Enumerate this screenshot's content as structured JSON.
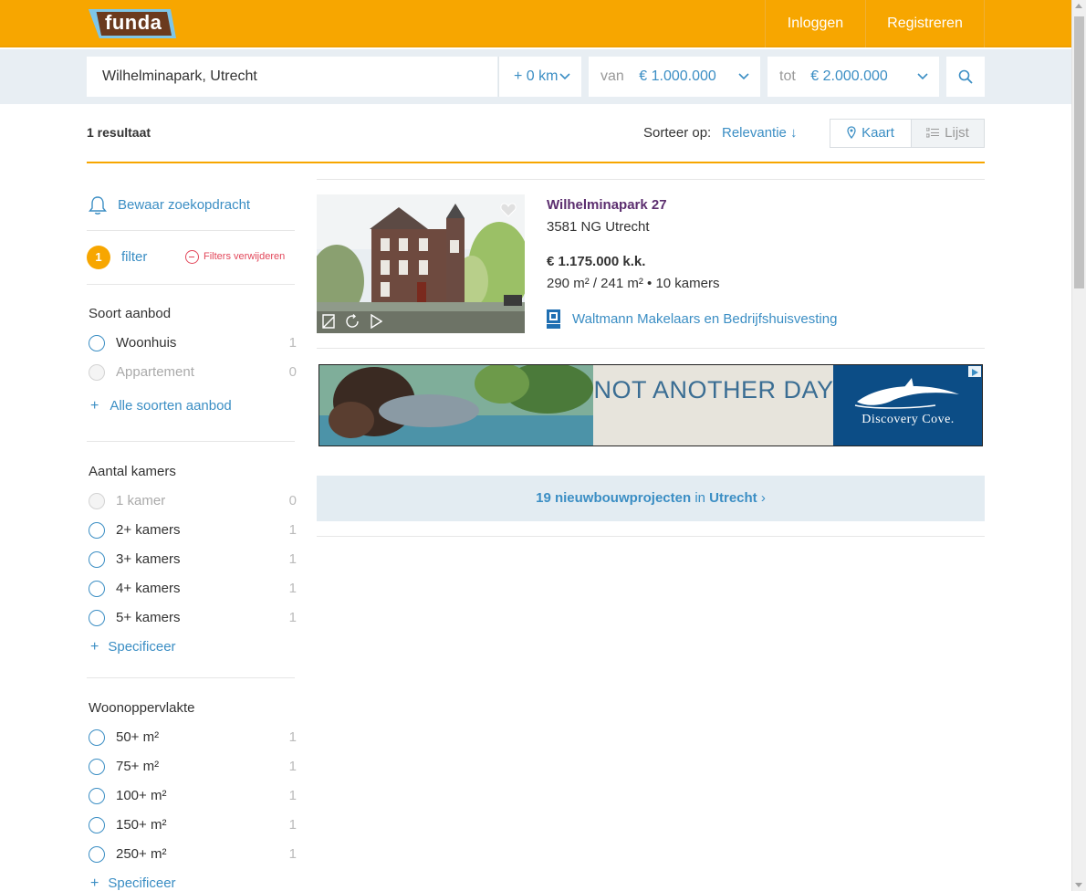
{
  "header": {
    "logo_text": "funda",
    "login_label": "Inloggen",
    "register_label": "Registreren"
  },
  "search": {
    "location": "Wilhelminapark, Utrecht",
    "radius": "+ 0 km",
    "min_prefix": "van",
    "min_value": "€ 1.000.000",
    "max_prefix": "tot",
    "max_value": "€ 2.000.000",
    "icons": {
      "chevron": "chevron-down-icon",
      "search": "search-icon"
    }
  },
  "results": {
    "count_label": "1 resultaat",
    "sort_label": "Sorteer op:",
    "sort_value": "Relevantie ↓",
    "view_map": "Kaart",
    "view_list": "Lijst"
  },
  "sidebar": {
    "save_search": "Bewaar zoekopdracht",
    "filter_count": "1",
    "filter_label": "filter",
    "remove_filters": "Filters verwijderen",
    "soort": {
      "title": "Soort aanbod",
      "options": [
        {
          "label": "Woonhuis",
          "count": "1"
        },
        {
          "label": "Appartement",
          "count": "0"
        }
      ],
      "more": "Alle soorten aanbod"
    },
    "kamers": {
      "title": "Aantal kamers",
      "options": [
        {
          "label": "1 kamer",
          "count": "0"
        },
        {
          "label": "2+ kamers",
          "count": "1"
        },
        {
          "label": "3+ kamers",
          "count": "1"
        },
        {
          "label": "4+ kamers",
          "count": "1"
        },
        {
          "label": "5+ kamers",
          "count": "1"
        }
      ],
      "more": "Specificeer"
    },
    "opp": {
      "title": "Woonoppervlakte",
      "options": [
        {
          "label": "50+ m²",
          "count": "1"
        },
        {
          "label": "75+ m²",
          "count": "1"
        },
        {
          "label": "100+ m²",
          "count": "1"
        },
        {
          "label": "150+ m²",
          "count": "1"
        },
        {
          "label": "250+ m²",
          "count": "1"
        }
      ],
      "more": "Specificeer"
    }
  },
  "listing": {
    "title": "Wilhelminapark 27",
    "zip": "3581 NG Utrecht",
    "price": "€ 1.175.000 k.k.",
    "specs": "290 m² / 241 m² • 10 kamers",
    "agent": "Waltmann Makelaars en Bedrijfshuisvesting",
    "icons": {
      "favorite": "heart-icon",
      "agent": "nvm-logo-icon"
    }
  },
  "ad": {
    "headline": "NOT ANOTHER DAY",
    "brand": "Discovery Cove."
  },
  "newbuild": {
    "count_text": "19 nieuwbouwprojecten",
    "connector": " in ",
    "city": "Utrecht",
    "arrow": " ›"
  },
  "colors": {
    "brand_orange": "#f7a600",
    "link_blue": "#3b8ec4",
    "title_purple": "#5c2e6f",
    "danger_red": "#e2475a"
  }
}
